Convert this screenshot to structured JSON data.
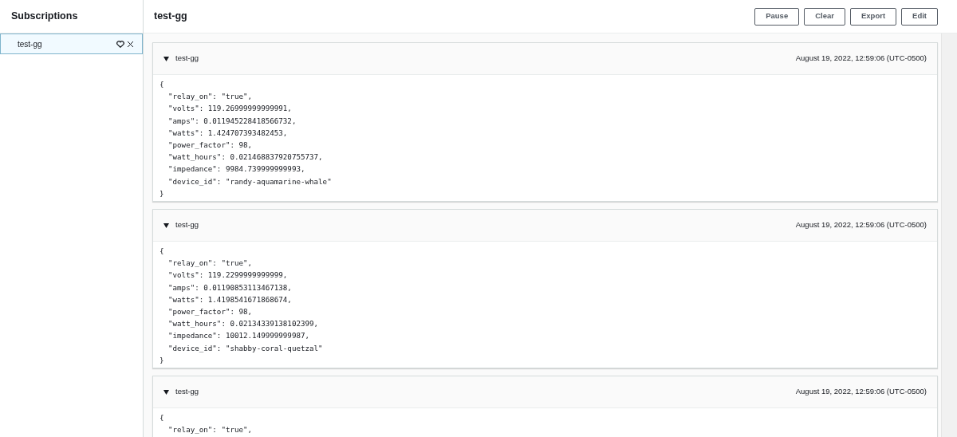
{
  "sidebar": {
    "title": "Subscriptions",
    "items": [
      {
        "label": "test-gg",
        "selected": true
      }
    ]
  },
  "main": {
    "title": "test-gg",
    "buttons": [
      "Pause",
      "Clear",
      "Export",
      "Edit"
    ],
    "messages": [
      {
        "topic": "test-gg",
        "expanded": true,
        "time": "August 19, 2022, 12:59:06 (UTC-0500)",
        "lines": [
          {
            "kind": "brace",
            "text": "{"
          },
          {
            "kind": "field",
            "text": "\"relay_on\": \"true\","
          },
          {
            "kind": "field",
            "text": "\"volts\": 119.26999999999991,"
          },
          {
            "kind": "field",
            "text": "\"amps\": 0.011945228418566732,"
          },
          {
            "kind": "field",
            "text": "\"watts\": 1.424707393482453,"
          },
          {
            "kind": "field",
            "text": "\"power_factor\": 98,"
          },
          {
            "kind": "field",
            "text": "\"watt_hours\": 0.021468837920755737,"
          },
          {
            "kind": "field",
            "text": "\"impedance\": 9984.739999999993,"
          },
          {
            "kind": "field",
            "text": "\"device_id\": \"randy-aquamarine-whale\""
          },
          {
            "kind": "brace",
            "text": "}"
          }
        ]
      },
      {
        "topic": "test-gg",
        "expanded": true,
        "time": "August 19, 2022, 12:59:06 (UTC-0500)",
        "lines": [
          {
            "kind": "brace",
            "text": "{"
          },
          {
            "kind": "field",
            "text": "\"relay_on\": \"true\","
          },
          {
            "kind": "field",
            "text": "\"volts\": 119.2299999999999,"
          },
          {
            "kind": "field",
            "text": "\"amps\": 0.01190853113467138,"
          },
          {
            "kind": "field",
            "text": "\"watts\": 1.4198541671868674,"
          },
          {
            "kind": "field",
            "text": "\"power_factor\": 98,"
          },
          {
            "kind": "field",
            "text": "\"watt_hours\": 0.02134339138102399,"
          },
          {
            "kind": "field",
            "text": "\"impedance\": 10012.149999999987,"
          },
          {
            "kind": "field",
            "text": "\"device_id\": \"shabby-coral-quetzal\""
          },
          {
            "kind": "brace",
            "text": "}"
          }
        ]
      },
      {
        "topic": "test-gg",
        "expanded": true,
        "time": "August 19, 2022, 12:59:06 (UTC-0500)",
        "lines": [
          {
            "kind": "brace",
            "text": "{"
          },
          {
            "kind": "field",
            "text": "\"relay_on\": \"true\","
          }
        ]
      }
    ]
  }
}
